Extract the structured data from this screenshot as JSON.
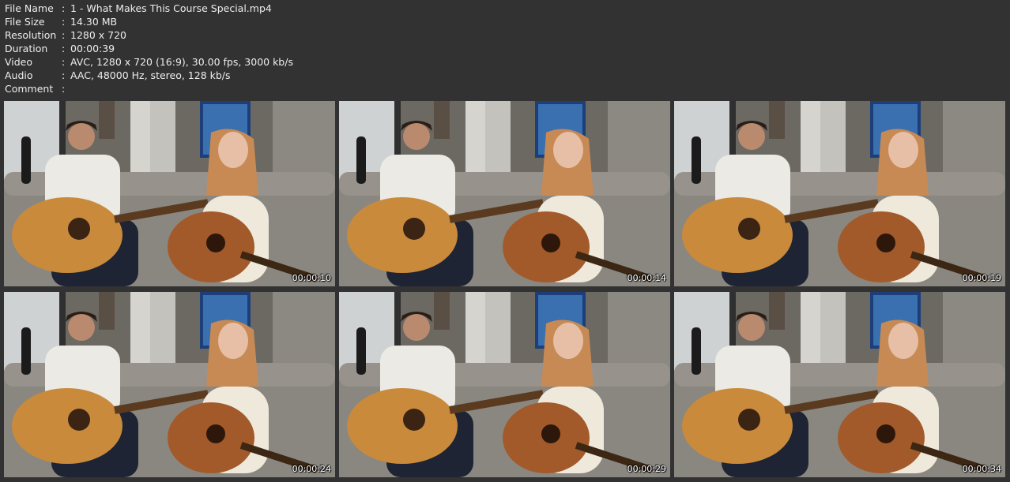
{
  "info": [
    {
      "key": "File Name",
      "sep": ":",
      "value": "1 - What Makes This Course Special.mp4"
    },
    {
      "key": "File Size",
      "sep": ":",
      "value": "14.30 MB"
    },
    {
      "key": "Resolution",
      "sep": ":",
      "value": "1280 x 720"
    },
    {
      "key": "Duration",
      "sep": ":",
      "value": "00:00:39"
    },
    {
      "key": "Video",
      "sep": ":",
      "value": "AVC, 1280 x 720 (16:9), 30.00 fps, 3000 kb/s"
    },
    {
      "key": "Audio",
      "sep": ":",
      "value": "AAC, 48000 Hz, stereo, 128 kb/s"
    },
    {
      "key": "Comment",
      "sep": ":",
      "value": ""
    }
  ],
  "thumbnails": [
    {
      "timestamp": "00:00:10"
    },
    {
      "timestamp": "00:00:14"
    },
    {
      "timestamp": "00:00:19"
    },
    {
      "timestamp": "00:00:24"
    },
    {
      "timestamp": "00:00:29"
    },
    {
      "timestamp": "00:00:34"
    }
  ],
  "colors": {
    "background": "#323232",
    "text": "#ededed",
    "wall": "#6c6862",
    "sofa": "#8a8780",
    "guitar": "#c98a3c"
  }
}
